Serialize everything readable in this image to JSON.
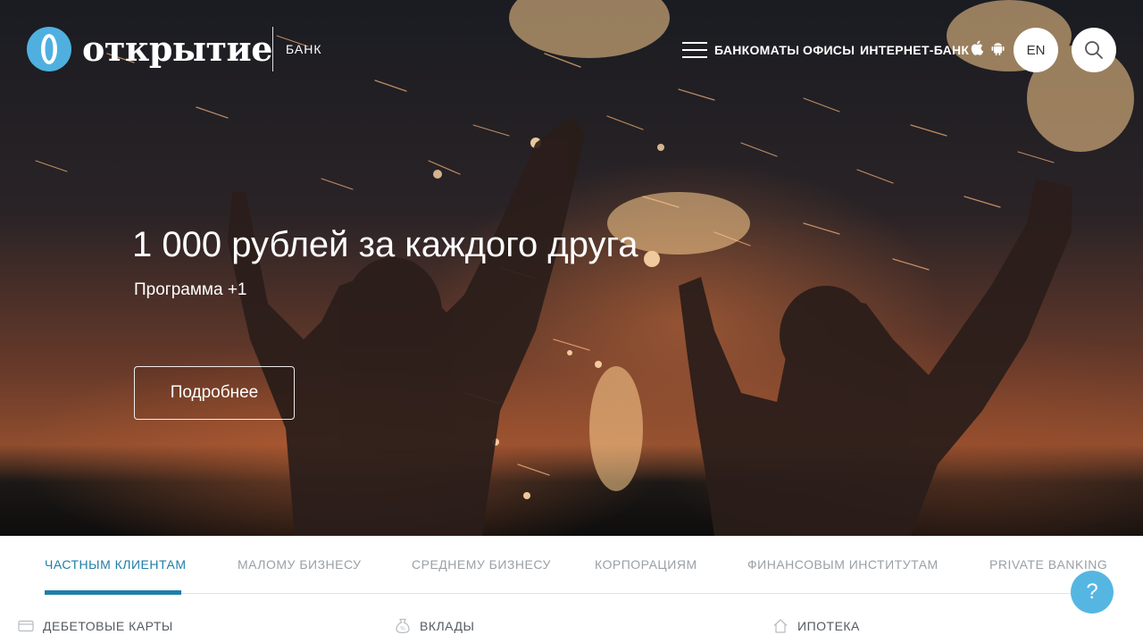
{
  "header": {
    "logo_text": "открытие",
    "logo_sub": "БАНК",
    "nav": [
      "БАНКОМАТЫ",
      "ОФИСЫ",
      "ИНТЕРНЕТ-БАНК"
    ],
    "lang": "EN",
    "icons": {
      "menu": "hamburger-icon",
      "apple": "apple-icon",
      "android": "android-icon",
      "search": "search-icon"
    }
  },
  "hero": {
    "title": "1 000 рублей за каждого друга",
    "subtitle": "Программа +1",
    "button": "Подробнее"
  },
  "tabs": [
    "ЧАСТНЫМ КЛИЕНТАМ",
    "МАЛОМУ БИЗНЕСУ",
    "СРЕДНЕМУ БИЗНЕСУ",
    "КОРПОРАЦИЯМ",
    "ФИНАНСОВЫМ ИНСТИТУТАМ",
    "PRIVATE BANKING"
  ],
  "active_tab": "ЧАСТНЫМ КЛИЕНТАМ",
  "subnav": [
    "ДЕБЕТОВЫЕ КАРТЫ",
    "ВКЛАДЫ",
    "ИПОТЕКА"
  ],
  "help_label": "?",
  "colors": {
    "accent": "#1f7ea8",
    "logo_blue": "#4fb0e0",
    "help": "#56b6e2"
  }
}
